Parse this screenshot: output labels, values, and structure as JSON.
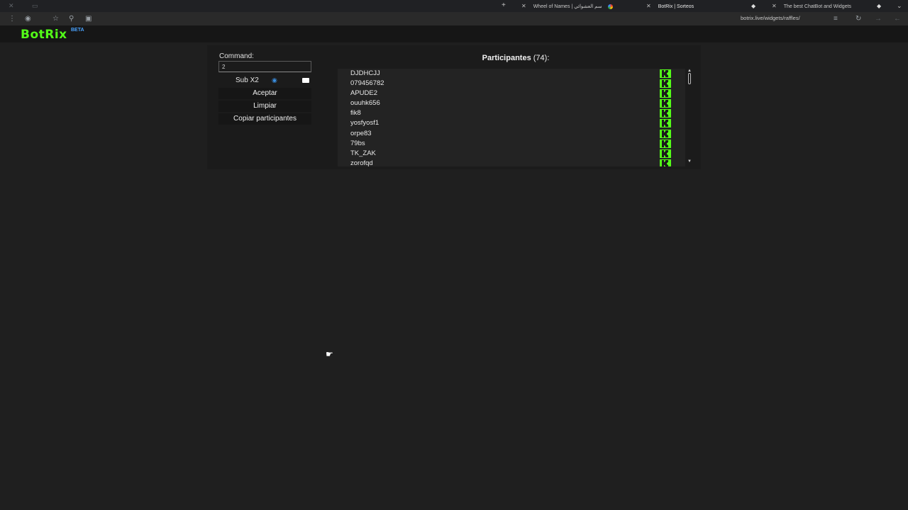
{
  "browser": {
    "tabs": [
      {
        "label": "Wheel of Names | سم العشوائي",
        "active": false
      },
      {
        "label": "BotRix | Sorteos",
        "active": true
      },
      {
        "label": "The best ChatBot and Widgets",
        "active": false
      }
    ],
    "new_tab_symbol": "+",
    "close_symbol": "✕",
    "url": "botrix.live/widgets/raffles/"
  },
  "app": {
    "logo": "BotRix",
    "badge": "BETA",
    "brand_color": "#53fc18"
  },
  "controls": {
    "command_label": "Command:",
    "command_value": "2",
    "sub_option_label": "Sub X2",
    "accept_label": "Aceptar",
    "clear_label": "Limpiar",
    "copy_label": "Copiar participantes"
  },
  "participants": {
    "title": "Participantes",
    "count": "(74):",
    "items": [
      "DJDHCJJ",
      "079456782",
      "APUDE2",
      "ouuhk656",
      "fik8",
      "yosfyosf1",
      "orpe83",
      "79bs",
      "TK_ZAK",
      "zorofqd"
    ],
    "platform_icon": "kick-icon"
  }
}
